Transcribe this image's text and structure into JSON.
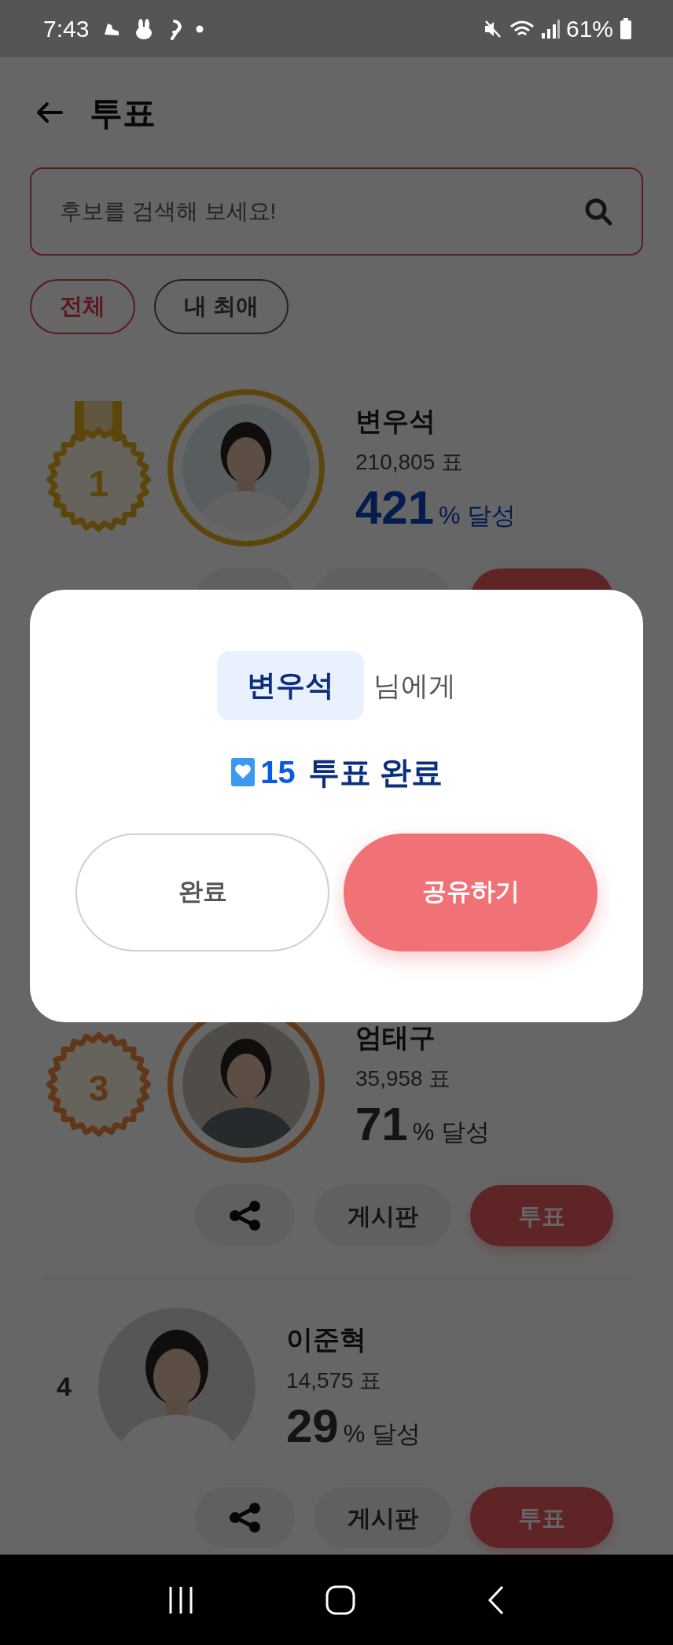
{
  "status_bar": {
    "time": "7:43",
    "battery": "61%"
  },
  "header": {
    "title": "투표"
  },
  "search": {
    "placeholder": "후보를 검색해 보세요!"
  },
  "filters": [
    {
      "label": "전체",
      "selected": true
    },
    {
      "label": "내 최애",
      "selected": false
    }
  ],
  "candidates": [
    {
      "rank": "1",
      "kind": "gold",
      "ribbon": true,
      "name": "변우석",
      "votes": "210,805 표",
      "percent": "421",
      "percent_suffix": "% 달성",
      "highlight": true
    },
    {
      "rank": "3",
      "kind": "bronze",
      "ribbon": false,
      "name": "엄태구",
      "votes": "35,958 표",
      "percent": "71",
      "percent_suffix": "% 달성",
      "highlight": false,
      "actions": {
        "board": "게시판",
        "vote": "투표"
      }
    },
    {
      "rank": "4",
      "kind": "plain",
      "name": "이준혁",
      "votes": "14,575 표",
      "percent": "29",
      "percent_suffix": "% 달성",
      "highlight": false,
      "actions": {
        "board": "게시판",
        "vote": "투표"
      }
    }
  ],
  "dialog": {
    "recipient": "변우석",
    "recipient_suffix": "님에게",
    "count": "15",
    "message": "투표 완료",
    "buttons": [
      {
        "label": "완료",
        "kind": "secondary"
      },
      {
        "label": "공유하기",
        "kind": "primary"
      }
    ]
  }
}
